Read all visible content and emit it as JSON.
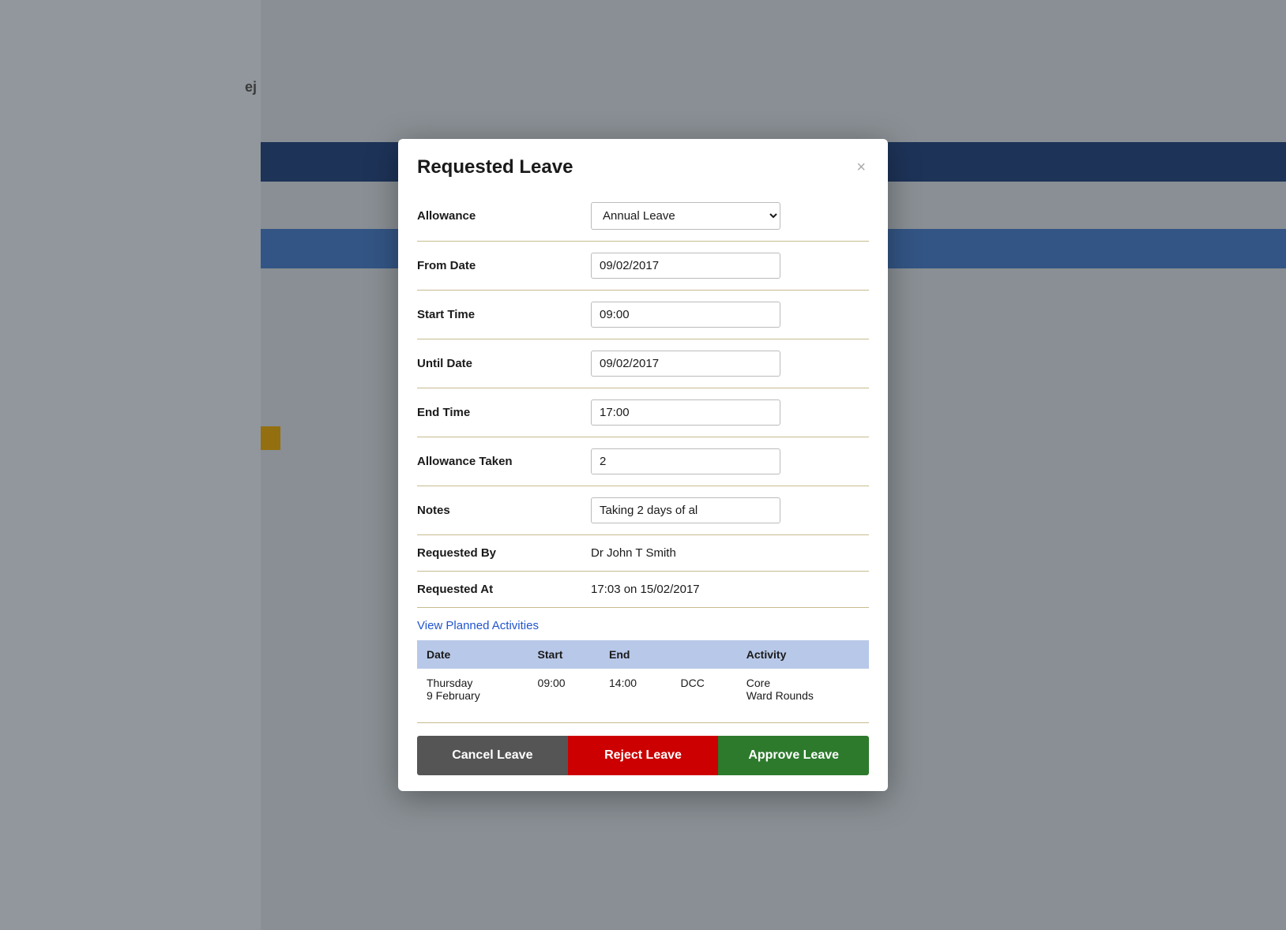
{
  "background": {
    "sidebar_text": "ej"
  },
  "modal": {
    "title": "Requested Leave",
    "close_label": "×",
    "fields": {
      "allowance_label": "Allowance",
      "allowance_value": "Annual Leave",
      "from_date_label": "From Date",
      "from_date_value": "09/02/2017",
      "start_time_label": "Start Time",
      "start_time_value": "09:00",
      "until_date_label": "Until Date",
      "until_date_value": "09/02/2017",
      "end_time_label": "End Time",
      "end_time_value": "17:00",
      "allowance_taken_label": "Allowance Taken",
      "allowance_taken_value": "2",
      "notes_label": "Notes",
      "notes_value": "Taking 2 days of al",
      "requested_by_label": "Requested By",
      "requested_by_value": "Dr John T Smith",
      "requested_at_label": "Requested At",
      "requested_at_value": "17:03 on 15/02/2017"
    },
    "view_activities_link": "View Planned Activities",
    "activities_table": {
      "headers": [
        "Date",
        "Start",
        "End",
        "",
        "Activity"
      ],
      "rows": [
        {
          "date": "Thursday\n9 February",
          "date_line1": "Thursday",
          "date_line2": "9 February",
          "start": "09:00",
          "end": "14:00",
          "code": "DCC",
          "activity": "Core\nWard Rounds",
          "activity_line1": "Core",
          "activity_line2": "Ward Rounds"
        }
      ]
    },
    "buttons": {
      "cancel_label": "Cancel Leave",
      "reject_label": "Reject Leave",
      "approve_label": "Approve Leave"
    }
  }
}
